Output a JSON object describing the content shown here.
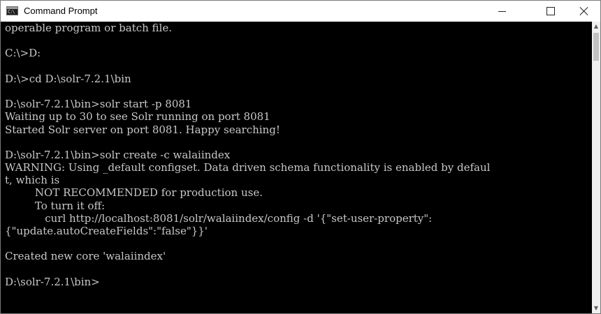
{
  "window": {
    "title": "Command Prompt",
    "app_icon": "cmd-icon",
    "controls": {
      "minimize_icon": "minimize-icon",
      "maximize_icon": "maximize-icon",
      "close_icon": "close-icon"
    }
  },
  "console": {
    "colors": {
      "background": "#000000",
      "foreground": "#c8c8c8"
    },
    "lines": [
      "operable program or batch file.",
      "",
      "C:\\>D:",
      "",
      "D:\\>cd D:\\solr-7.2.1\\bin",
      "",
      "D:\\solr-7.2.1\\bin>solr start -p 8081",
      "Waiting up to 30 to see Solr running on port 8081",
      "Started Solr server on port 8081. Happy searching!",
      "",
      "D:\\solr-7.2.1\\bin>solr create -c walaiindex",
      "WARNING: Using _default configset. Data driven schema functionality is enabled by defaul",
      "t, which is",
      "         NOT RECOMMENDED for production use.",
      "         To turn it off:",
      "            curl http://localhost:8081/solr/walaiindex/config -d '{\"set-user-property\":",
      "{\"update.autoCreateFields\":\"false\"}}'",
      "",
      "Created new core 'walaiindex'",
      "",
      "D:\\solr-7.2.1\\bin>"
    ]
  },
  "scrollbar": {
    "up_icon": "scroll-up-arrow-icon",
    "down_icon": "scroll-down-arrow-icon"
  }
}
